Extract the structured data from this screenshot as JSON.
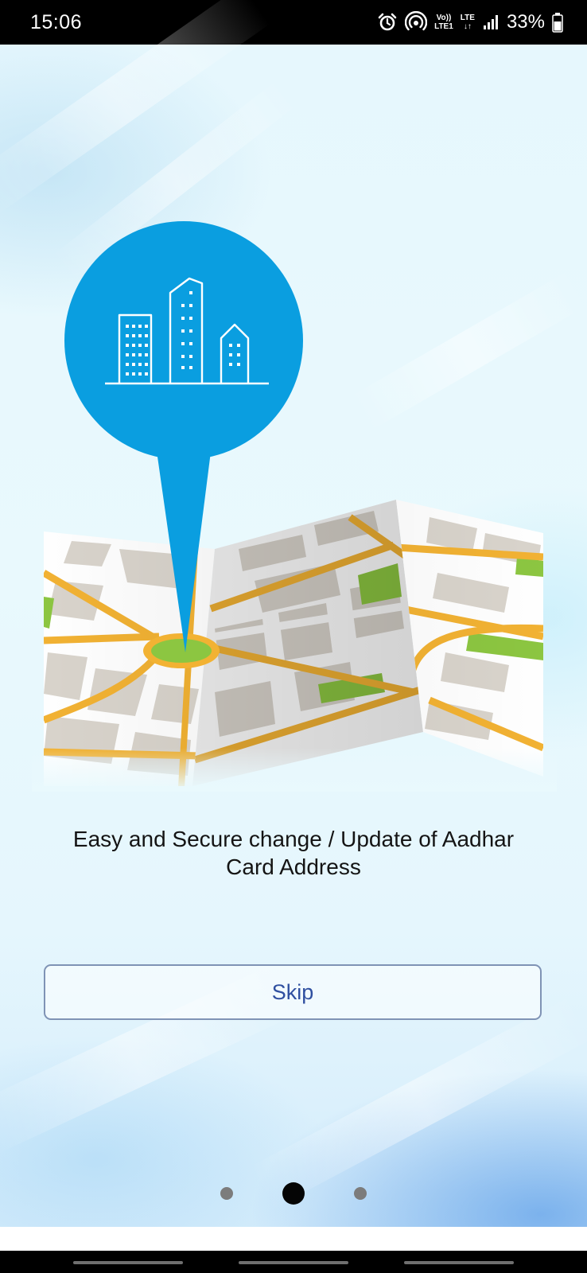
{
  "status_bar": {
    "time": "15:06",
    "volte_top": "Vo))",
    "volte_bottom": "LTE1",
    "lte_top": "LTE",
    "lte_bottom": "↓↑",
    "battery_percent": "33%",
    "icons": [
      "alarm-icon",
      "hotspot-icon",
      "signal-icon",
      "battery-icon"
    ]
  },
  "illustration": {
    "description_icons": [
      "location-pin-icon",
      "buildings-icon",
      "map-icon"
    ],
    "colors": {
      "pin": "#0a9ee0",
      "road": "#f2b233",
      "park": "#8cc641",
      "block": "#d9d4cc",
      "street": "#ffffff"
    }
  },
  "onboarding": {
    "caption_line1": "Easy and Secure change / Update of Aadhar",
    "caption_line2": "Card Address",
    "skip_label": "Skip"
  },
  "pager": {
    "total_pages": 3,
    "active_index": 1
  },
  "colors": {
    "accent": "#2f4fa0",
    "button_border": "#7f93b5",
    "status_bar": "#000000"
  }
}
